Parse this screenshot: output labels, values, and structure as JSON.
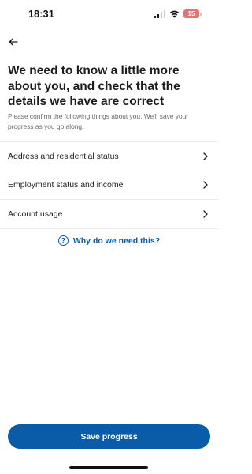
{
  "status_bar": {
    "time": "18:31",
    "battery_level": "15",
    "battery_color": "#e0766f"
  },
  "header": {
    "back_icon": "arrow-left-icon"
  },
  "page": {
    "title": "We need to know a little more about you, and check that the details we have are correct",
    "subtitle": "Please confirm the following things about you. We'll save your progress as you go along."
  },
  "menu": {
    "items": [
      {
        "label": "Address and residential status",
        "icon": "chevron-right-icon"
      },
      {
        "label": "Employment status and income",
        "icon": "chevron-right-icon"
      },
      {
        "label": "Account usage",
        "icon": "chevron-right-icon"
      }
    ]
  },
  "help": {
    "icon_glyph": "?",
    "label": "Why do we need this?"
  },
  "footer": {
    "save_label": "Save progress"
  },
  "colors": {
    "accent": "#0a5ca8",
    "text": "#1c1c1c",
    "muted": "#6a6a6a",
    "divider": "#ebebeb"
  }
}
